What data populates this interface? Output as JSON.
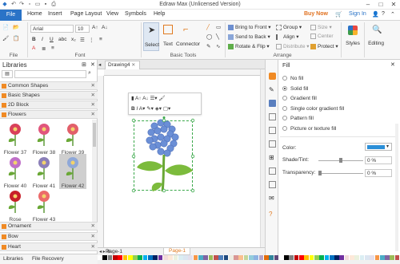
{
  "title_bar": {
    "title": "Edraw Max (Unlicensed Version)"
  },
  "menu": {
    "file": "File",
    "items": [
      "Home",
      "Insert",
      "Page Layout",
      "View",
      "Symbols",
      "Help"
    ],
    "buy_now": "Buy Now",
    "sign_in": "Sign In"
  },
  "ribbon": {
    "file_group_label": "File",
    "font": {
      "family": "Arial",
      "size": "10",
      "group_label": "Font"
    },
    "basic_tools": {
      "select": "Select",
      "text": "Text",
      "connector": "Connector",
      "group_label": "Basic Tools"
    },
    "arrange": {
      "bring_to_front": "Bring to Front",
      "send_to_back": "Send to Back",
      "rotate_flip": "Rotate & Flip",
      "group": "Group",
      "align": "Align",
      "distribute": "Distribute",
      "size": "Size",
      "center": "Center",
      "protect": "Protect",
      "group_label": "Arrange"
    },
    "styles": "Styles",
    "editing": "Editing"
  },
  "libraries": {
    "title": "Libraries",
    "sections": [
      {
        "name": "Common Shapes"
      },
      {
        "name": "Basic Shapes"
      },
      {
        "name": "2D Block"
      },
      {
        "name": "Flowers"
      }
    ],
    "flowers": [
      {
        "label": "Flower 37",
        "color": "#d9415a"
      },
      {
        "label": "Flower 38",
        "color": "#e0567c"
      },
      {
        "label": "Flower 39",
        "color": "#e2606a"
      },
      {
        "label": "Flower 40",
        "color": "#c070c8"
      },
      {
        "label": "Flower 41",
        "color": "#8b7fb8"
      },
      {
        "label": "Flower 42",
        "color": "#8fa8d8"
      },
      {
        "label": "Rose",
        "color": "#c8202a"
      },
      {
        "label": "Flower 43",
        "color": "#ec6a6a"
      }
    ],
    "bottom_sections": [
      {
        "name": "Ornament"
      },
      {
        "name": "Bow"
      },
      {
        "name": "Heart"
      }
    ]
  },
  "document": {
    "tab": "Drawing4",
    "pages": [
      "Page-1",
      "Page-1"
    ],
    "flower_color": "#6b8fd6",
    "leaf_color": "#7cbb3c"
  },
  "fill_panel": {
    "title": "Fill",
    "options": [
      {
        "label": "No fill",
        "selected": false
      },
      {
        "label": "Solid fill",
        "selected": true
      },
      {
        "label": "Gradient fill",
        "selected": false
      },
      {
        "label": "Single color gradient fill",
        "selected": false
      },
      {
        "label": "Pattern fill",
        "selected": false
      },
      {
        "label": "Picture or texture fill",
        "selected": false
      }
    ],
    "color_label": "Color:",
    "color_value": "#2b8fd8",
    "shade_label": "Shade/Tint:",
    "shade_value": "0 %",
    "transparency_label": "Transparency:",
    "transparency_value": "0 %"
  },
  "bottom_tabs": [
    "Libraries",
    "File Recovery"
  ],
  "colors": {
    "accent": "#2a73c7",
    "highlight": "#f08a24"
  }
}
